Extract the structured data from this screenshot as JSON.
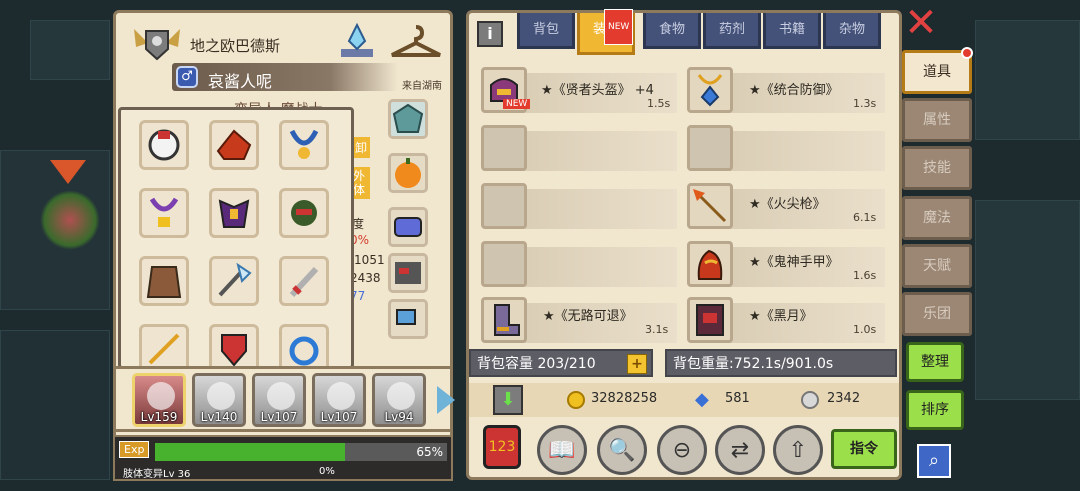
{
  "character": {
    "title": "地之欧巴德斯",
    "name": "哀酱人呢",
    "origin": "来自湖南",
    "subtitle": "变异人 魔战士",
    "heroes": [
      {
        "level": "Lv159",
        "selected": true
      },
      {
        "level": "Lv140"
      },
      {
        "level": "Lv107"
      },
      {
        "level": "Lv107"
      },
      {
        "level": "Lv94"
      }
    ],
    "exp_label": "Exp",
    "exp_percent": "65%",
    "exp_value": 0.65,
    "skill_label": "肢体变异Lv 36",
    "skill_percent": "0%"
  },
  "inventory": {
    "tabs": [
      {
        "label": "背包"
      },
      {
        "label": "装备",
        "active": true,
        "new": "NEW"
      },
      {
        "label": "食物"
      },
      {
        "label": "药剂"
      },
      {
        "label": "书籍"
      },
      {
        "label": "杂物"
      }
    ],
    "items": [
      {
        "name": "★《贤者头盔》 +4",
        "time": "1.5s",
        "new": "NEW",
        "icon": "helmet-icon"
      },
      {
        "name": "★《统合防御》",
        "time": "1.3s",
        "icon": "necklace-icon"
      },
      {
        "name": "",
        "time": "",
        "icon": "empty-slot"
      },
      {
        "name": "",
        "time": "",
        "icon": "empty-slot"
      },
      {
        "name": "",
        "time": "",
        "icon": "empty-slot"
      },
      {
        "name": "★《火尖枪》",
        "time": "6.1s",
        "icon": "spear-icon"
      },
      {
        "name": "",
        "time": "",
        "icon": "empty-slot"
      },
      {
        "name": "★《鬼神手甲》",
        "time": "1.6s",
        "icon": "gauntlet-icon"
      },
      {
        "name": "★《无路可退》",
        "time": "3.1s",
        "icon": "boots-icon"
      },
      {
        "name": "★《黑月》",
        "time": "1.0s",
        "icon": "book-icon"
      }
    ],
    "capacity": "背包容量 203/210",
    "weight": "背包重量:752.1s/901.0s",
    "gold": "32828258",
    "diamonds": "581",
    "silver": "2342",
    "command_label": "指令"
  },
  "side_tabs": [
    {
      "label": "道具",
      "active": true
    },
    {
      "label": "属性"
    },
    {
      "label": "技能"
    },
    {
      "label": "魔法"
    },
    {
      "label": "天赋"
    },
    {
      "label": "乐团"
    }
  ],
  "buttons": {
    "organize": "整理",
    "sort": "排序"
  },
  "stats_peek": {
    "a": "/1051",
    "b": "2438",
    "c": "77",
    "d": "0%",
    "e": "度",
    "f": "卸",
    "g": "外体"
  },
  "colors": {
    "accent": "#f0b733",
    "tab": "#44527a",
    "green": "#9be04a"
  }
}
